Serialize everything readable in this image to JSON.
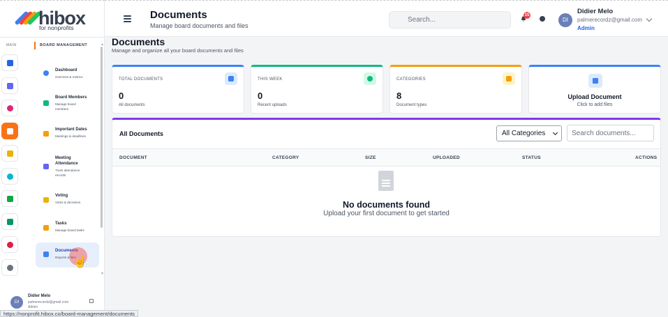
{
  "header": {
    "title": "Documents",
    "subtitle": "Manage board documents and files",
    "search_placeholder": "Search...",
    "notification_count": "15",
    "user": {
      "name": "Didier Melo",
      "email": "palmerecordz@gmail.com",
      "role": "Admin",
      "initials": "DI"
    }
  },
  "brand": {
    "name": "hibox",
    "tagline": "for nonprofits"
  },
  "sidebar": {
    "rail_title": "MAIN",
    "rail_items": [
      {
        "name": "home",
        "color": "#2563eb"
      },
      {
        "name": "org",
        "color": "#6366f1"
      },
      {
        "name": "pill",
        "color": "#db2777"
      },
      {
        "name": "board",
        "color": "#f97316",
        "active": true
      },
      {
        "name": "education",
        "color": "#eab308"
      },
      {
        "name": "globe",
        "color": "#06b6d4"
      },
      {
        "name": "network",
        "color": "#16a34a"
      },
      {
        "name": "people",
        "color": "#059669"
      },
      {
        "name": "chart",
        "color": "#e11d48"
      },
      {
        "name": "settings",
        "color": "#6b7280"
      }
    ],
    "panel_title": "BOARD MANAGEMENT",
    "menu": [
      {
        "title": "Dashboard",
        "sub": "Overview & metrics",
        "color": "#3b82f6"
      },
      {
        "title": "Board Members",
        "sub": "Manage board members",
        "color": "#10b981"
      },
      {
        "title": "Important Dates",
        "sub": "Meetings & deadlines",
        "color": "#f59e0b"
      },
      {
        "title": "Meeting Attendance",
        "sub": "Track attendance records",
        "color": "#6366f1"
      },
      {
        "title": "Voting",
        "sub": "Votes & decisions",
        "color": "#eab308"
      },
      {
        "title": "Tasks",
        "sub": "Manage board tasks",
        "color": "#f59e0b"
      },
      {
        "title": "Documents",
        "sub": "Reports & files",
        "color": "#3b82f6",
        "active": true
      }
    ],
    "footer": {
      "name": "Didier Melo",
      "email": "palmerecordz@gmail.com",
      "role": "Admin",
      "initials": "DI"
    }
  },
  "main": {
    "title": "Documents",
    "subtitle": "Manage and organize all your board documents and files",
    "stats": [
      {
        "label": "TOTAL DOCUMENTS",
        "value": "0",
        "desc": "All documents",
        "accent": "#3b82f6"
      },
      {
        "label": "THIS WEEK",
        "value": "0",
        "desc": "Recent uploads",
        "accent": "#10b981"
      },
      {
        "label": "CATEGORIES",
        "value": "8",
        "desc": "Document types",
        "accent": "#f59e0b"
      }
    ],
    "upload": {
      "title": "Upload Document",
      "sub": "Click to add files"
    },
    "table": {
      "title": "All Documents",
      "category_filter": "All Categories",
      "search_placeholder": "Search documents...",
      "columns": [
        "DOCUMENT",
        "CATEGORY",
        "SIZE",
        "UPLOADED",
        "STATUS",
        "ACTIONS"
      ],
      "empty_title": "No documents found",
      "empty_sub": "Upload your first document to get started"
    }
  },
  "status_bar_url": "https://nonprofit.hibox.co/board-management/documents"
}
